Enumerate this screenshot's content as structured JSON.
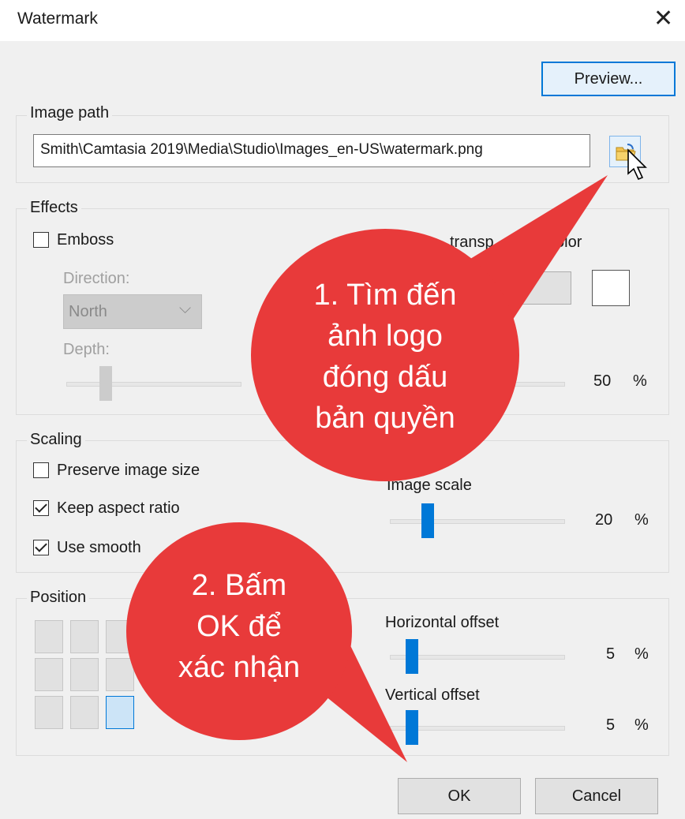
{
  "window": {
    "title": "Watermark"
  },
  "buttons": {
    "preview": "Preview...",
    "ok": "OK",
    "cancel": "Cancel"
  },
  "image_path": {
    "label": "Image path",
    "value": "Smith\\Camtasia 2019\\Media\\Studio\\Images_en-US\\watermark.png"
  },
  "effects": {
    "label": "Effects",
    "emboss": "Emboss",
    "emboss_checked": false,
    "direction_label": "Direction:",
    "direction_value": "North",
    "depth_label": "Depth:",
    "transparent_color_partial_a": "transp",
    "transparent_color_partial_b": "olor",
    "opacity_value": "50",
    "percent": "%"
  },
  "scaling": {
    "label": "Scaling",
    "preserve": "Preserve image size",
    "preserve_checked": false,
    "keep_aspect": "Keep aspect ratio",
    "keep_aspect_checked": true,
    "smooth": "Use smooth",
    "smooth_checked": true,
    "image_scale_label": "Image scale",
    "image_scale_value": "20",
    "percent": "%"
  },
  "position": {
    "label": "Position",
    "selected_cell": "bottom-right",
    "horizontal_label": "Horizontal offset",
    "horizontal_value": "5",
    "vertical_label": "Vertical offset",
    "vertical_value": "5",
    "percent": "%"
  },
  "callouts": {
    "one": [
      "1. Tìm đến",
      "ảnh logo",
      "đóng dấu",
      "bản quyền"
    ],
    "two": [
      "2. Bấm",
      "OK để",
      "xác nhận"
    ],
    "color": "#e83a3a"
  },
  "colors": {
    "accent": "#0078d7",
    "background": "#f0f0f0"
  }
}
